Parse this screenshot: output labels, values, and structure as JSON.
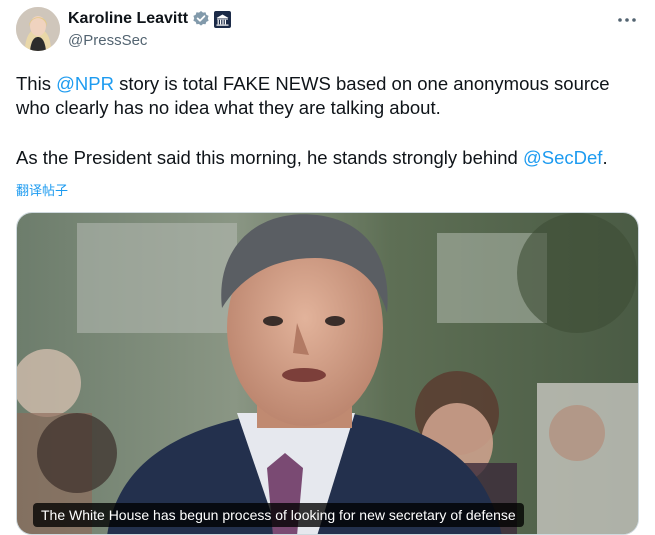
{
  "author": {
    "display_name": "Karoline Leavitt",
    "handle": "@PressSec",
    "avatar_icon": "avatar-photo",
    "verified_icon": "verified-badge-icon",
    "affiliation_icon": "white-house-badge-icon"
  },
  "menu": {
    "icon": "more-options-icon"
  },
  "tweet": {
    "line1": {
      "pre": "This ",
      "mention": "@NPR",
      "post": " story is total FAKE NEWS based on one anonymous source"
    },
    "line2": "who clearly has no idea what they are talking about.",
    "line3": {
      "pre": "As the President said this morning, he stands strongly behind ",
      "mention": "@SecDef",
      "post": "."
    },
    "translate_label": "翻译帖子"
  },
  "media": {
    "caption": "The White House has begun process of looking for new secretary of defense"
  },
  "colors": {
    "accent": "#1d9bf0",
    "text": "#0f1419",
    "secondary_text": "#536471",
    "gov_badge": "#1c2b48"
  }
}
